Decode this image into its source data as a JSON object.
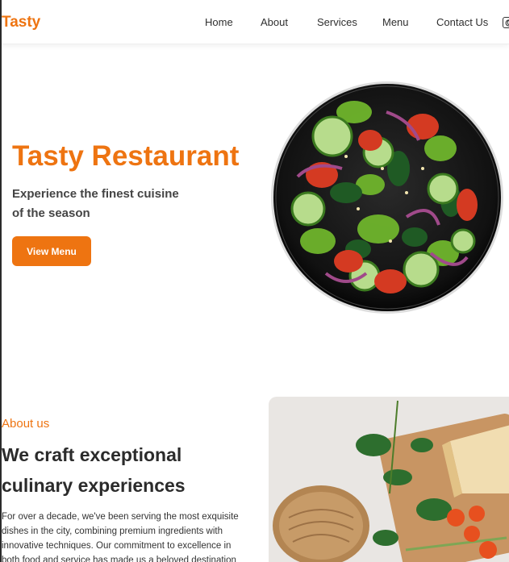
{
  "navbar": {
    "brand": "Tasty",
    "links": [
      "Home",
      "About",
      "Services",
      "Menu",
      "Contact Us"
    ],
    "theme_toggle_icon": "moon-icon"
  },
  "hero": {
    "title": "Tasty Restaurant",
    "subtitle": "Experience the finest cuisine of the season",
    "button_label": "View Menu",
    "image_icon": "salad-bowl-image"
  },
  "about": {
    "kicker": "About us",
    "title": "We craft exceptional culinary experiences",
    "body": "For over a decade, we've been serving the most exquisite dishes in the city, combining premium ingredients with innovative techniques. Our commitment to excellence in both food and service has made us a beloved destination",
    "image_icon": "ingredients-photo"
  },
  "colors": {
    "accent": "#ee7411",
    "text": "#2b2b2b",
    "background": "#ffffff"
  }
}
